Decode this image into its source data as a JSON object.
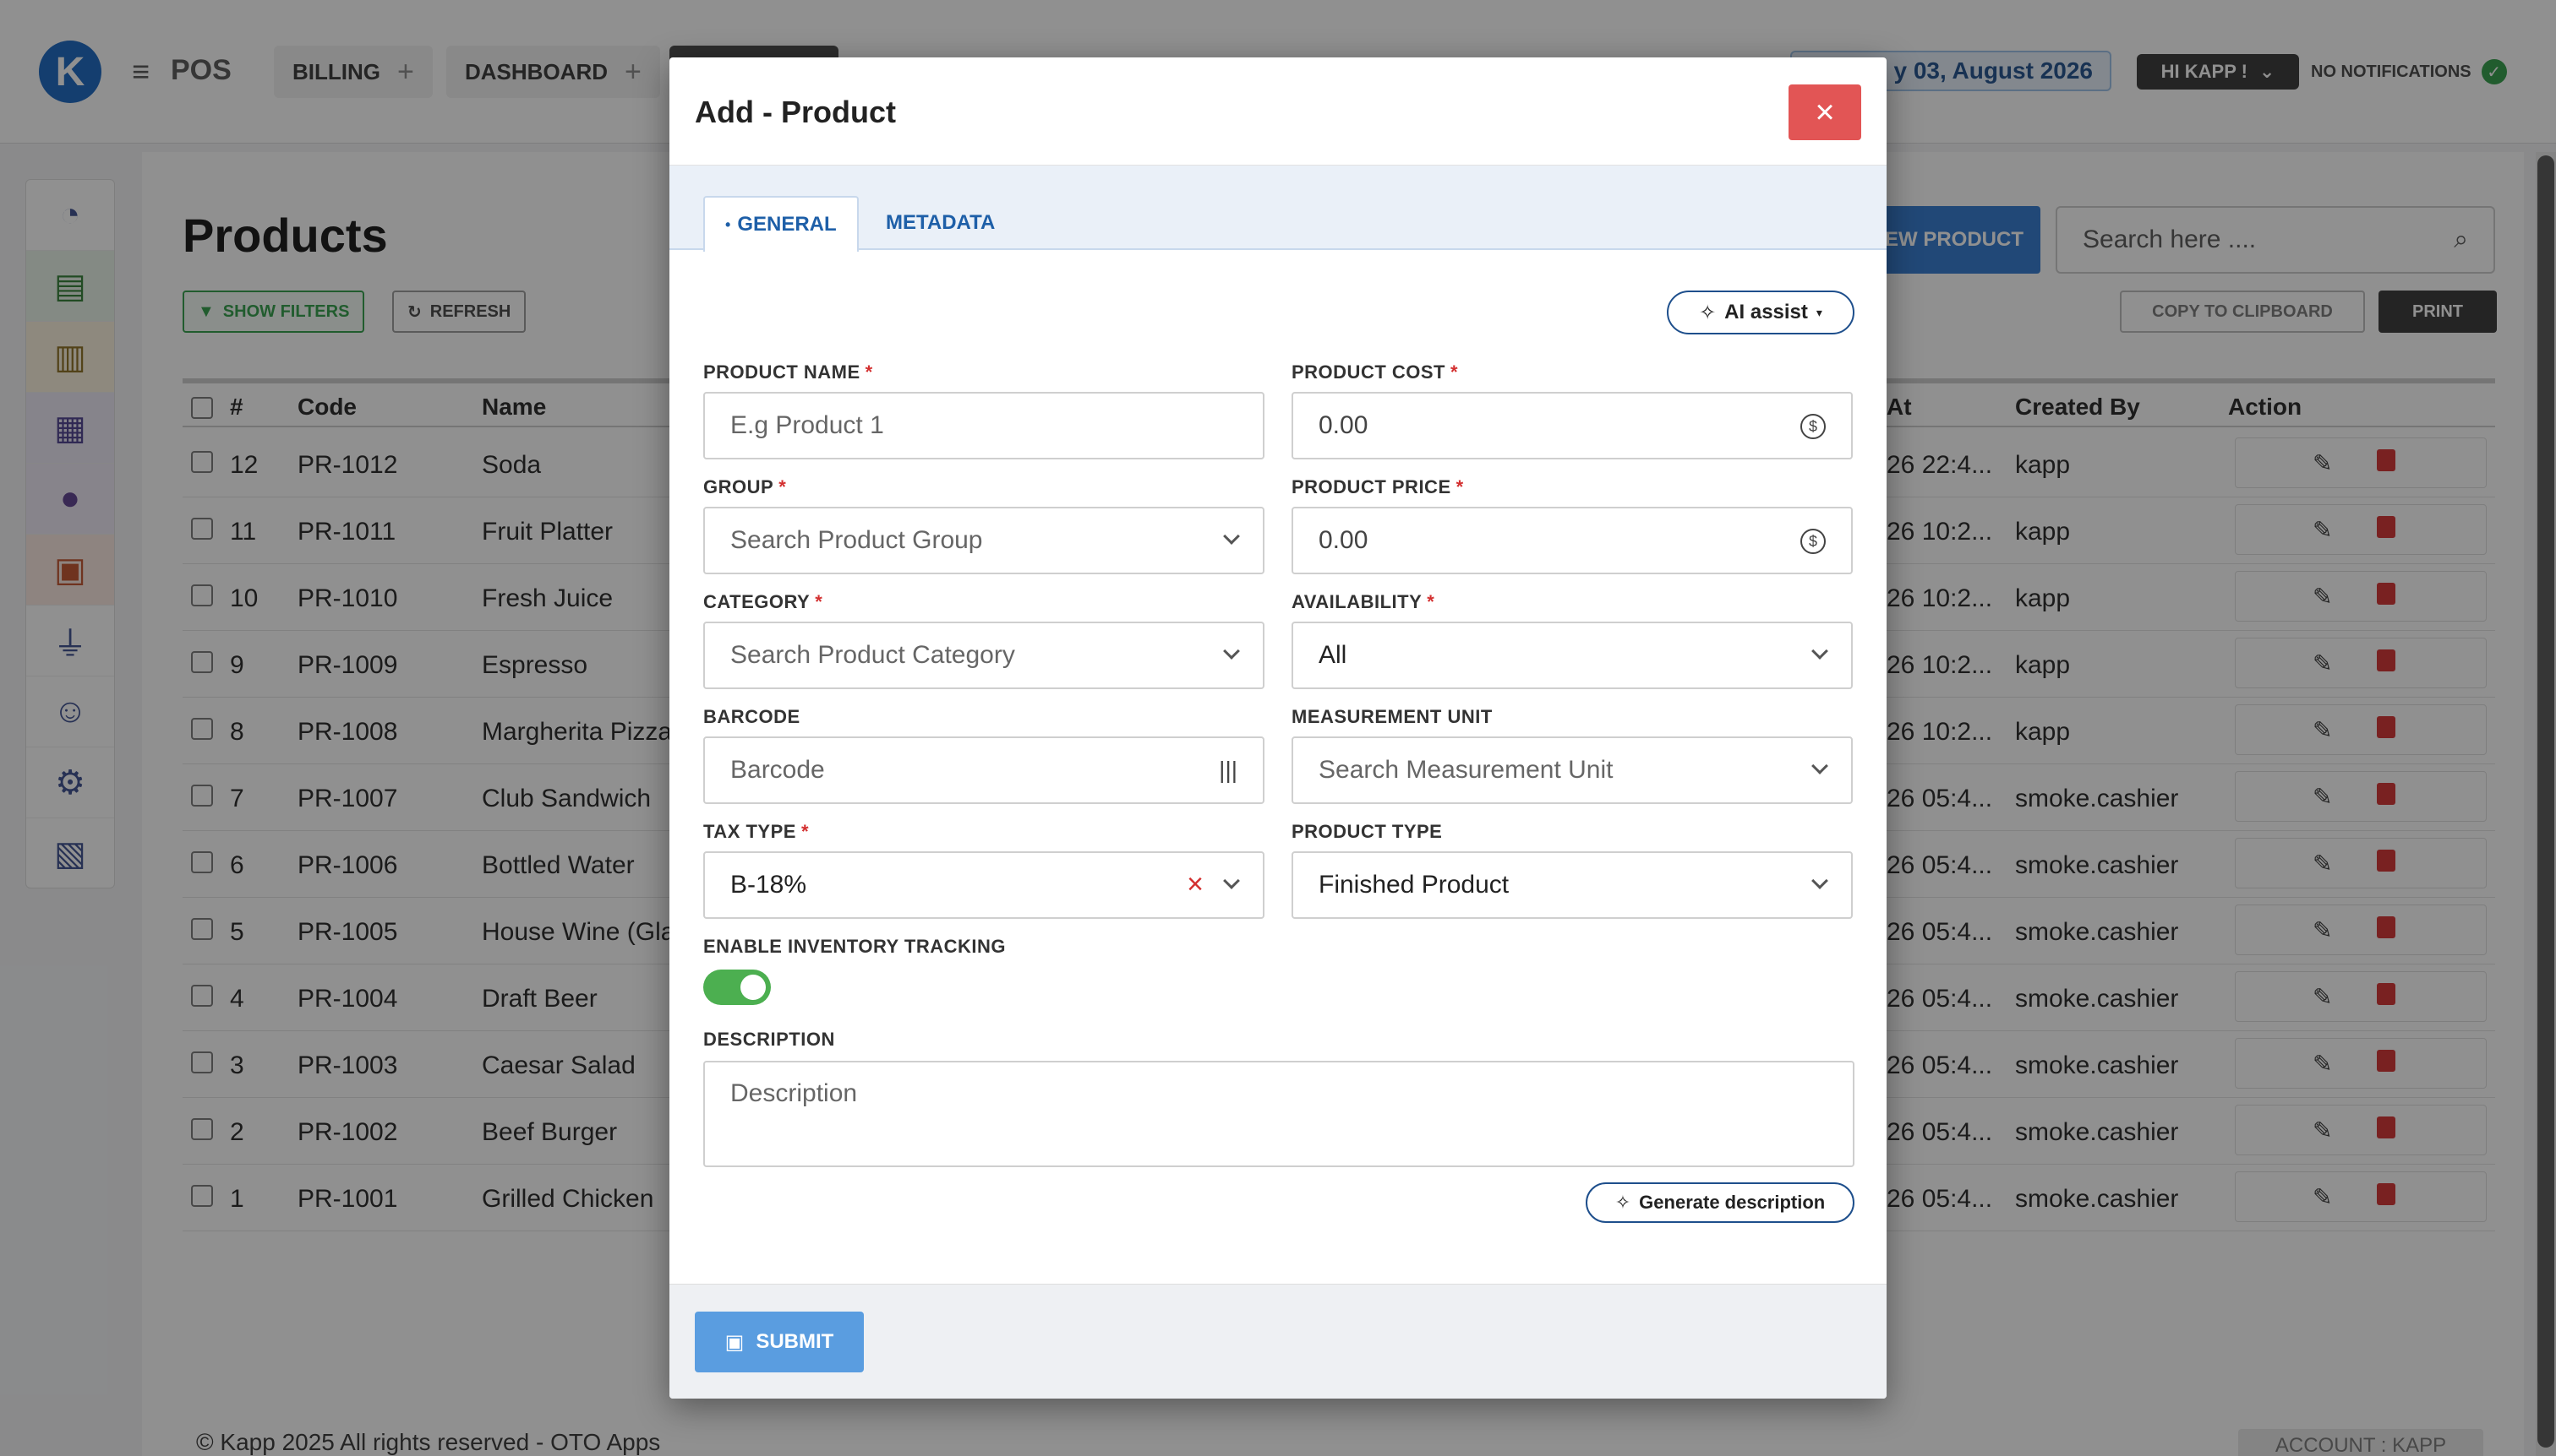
{
  "app": {
    "name": "POS",
    "logo_letter": "K",
    "tabs": [
      {
        "label": "BILLING"
      },
      {
        "label": "DASHBOARD"
      }
    ],
    "date": "y 03, August 2026",
    "user_greeting": "HI KAPP !",
    "notifications": "NO NOTIFICATIONS"
  },
  "page": {
    "title": "Products",
    "show_filters": "SHOW FILTERS",
    "refresh": "REFRESH",
    "new_product": "EW PRODUCT",
    "search_placeholder": "Search here ....",
    "copy_clipboard": "COPY TO CLIPBOARD",
    "print": "PRINT",
    "footer": "© Kapp 2025 All rights reserved - OTO Apps",
    "account": "ACCOUNT : KAPP"
  },
  "table": {
    "headers": {
      "num": "#",
      "code": "Code",
      "name": "Name",
      "at": "At",
      "created_by": "Created By",
      "action": "Action"
    },
    "rows": [
      {
        "num": "12",
        "code": "PR-1012",
        "name": "Soda",
        "at": "26 22:4...",
        "by": "kapp"
      },
      {
        "num": "11",
        "code": "PR-1011",
        "name": "Fruit Platter",
        "at": "26 10:2...",
        "by": "kapp"
      },
      {
        "num": "10",
        "code": "PR-1010",
        "name": "Fresh Juice",
        "at": "26 10:2...",
        "by": "kapp"
      },
      {
        "num": "9",
        "code": "PR-1009",
        "name": "Espresso",
        "at": "26 10:2...",
        "by": "kapp"
      },
      {
        "num": "8",
        "code": "PR-1008",
        "name": "Margherita Pizza",
        "at": "26 10:2...",
        "by": "kapp"
      },
      {
        "num": "7",
        "code": "PR-1007",
        "name": "Club Sandwich",
        "at": "26 05:4...",
        "by": "smoke.cashier"
      },
      {
        "num": "6",
        "code": "PR-1006",
        "name": "Bottled Water",
        "at": "26 05:4...",
        "by": "smoke.cashier"
      },
      {
        "num": "5",
        "code": "PR-1005",
        "name": "House Wine (Gla",
        "at": "26 05:4...",
        "by": "smoke.cashier"
      },
      {
        "num": "4",
        "code": "PR-1004",
        "name": "Draft Beer",
        "at": "26 05:4...",
        "by": "smoke.cashier"
      },
      {
        "num": "3",
        "code": "PR-1003",
        "name": "Caesar Salad",
        "at": "26 05:4...",
        "by": "smoke.cashier"
      },
      {
        "num": "2",
        "code": "PR-1002",
        "name": "Beef Burger",
        "at": "26 05:4...",
        "by": "smoke.cashier"
      },
      {
        "num": "1",
        "code": "PR-1001",
        "name": "Grilled Chicken",
        "at": "26 05:4...",
        "by": "smoke.cashier"
      }
    ]
  },
  "modal": {
    "title": "Add - Product",
    "tabs": {
      "general": "GENERAL",
      "metadata": "METADATA"
    },
    "ai_assist": "AI assist",
    "fields": {
      "product_name": {
        "label": "PRODUCT NAME",
        "placeholder": "E.g Product 1"
      },
      "product_cost": {
        "label": "PRODUCT COST",
        "value": "0.00"
      },
      "group": {
        "label": "GROUP",
        "placeholder": "Search Product Group"
      },
      "product_price": {
        "label": "PRODUCT PRICE",
        "value": "0.00"
      },
      "category": {
        "label": "CATEGORY",
        "placeholder": "Search Product Category"
      },
      "availability": {
        "label": "AVAILABILITY",
        "value": "All"
      },
      "barcode": {
        "label": "BARCODE",
        "placeholder": "Barcode"
      },
      "measurement_unit": {
        "label": "MEASUREMENT UNIT",
        "placeholder": "Search Measurement Unit"
      },
      "tax_type": {
        "label": "TAX TYPE",
        "value": "B-18%"
      },
      "product_type": {
        "label": "PRODUCT TYPE",
        "value": "Finished Product"
      },
      "inventory_tracking": {
        "label": "ENABLE INVENTORY TRACKING"
      },
      "description": {
        "label": "DESCRIPTION",
        "placeholder": "Description"
      }
    },
    "generate_description": "Generate description",
    "submit": "SUBMIT"
  }
}
